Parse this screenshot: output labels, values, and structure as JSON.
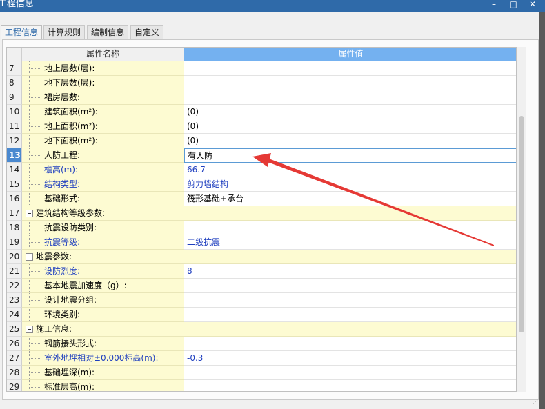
{
  "window": {
    "title": "工程信息",
    "min": "–",
    "max": "□",
    "close": "✕"
  },
  "tabs": [
    {
      "label": "工程信息",
      "active": true
    },
    {
      "label": "计算规则",
      "active": false
    },
    {
      "label": "编制信息",
      "active": false
    },
    {
      "label": "自定义",
      "active": false
    }
  ],
  "grid": {
    "col_name": "属性名称",
    "col_value": "属性值",
    "rows": [
      {
        "num": "7",
        "name": "地上层数(层):",
        "value": "",
        "group": false,
        "blue": false
      },
      {
        "num": "8",
        "name": "地下层数(层):",
        "value": "",
        "group": false,
        "blue": false
      },
      {
        "num": "9",
        "name": "裙房层数:",
        "value": "",
        "group": false,
        "blue": false
      },
      {
        "num": "10",
        "name": "建筑面积(m²):",
        "value": "(0)",
        "group": false,
        "blue": false
      },
      {
        "num": "11",
        "name": "地上面积(m²):",
        "value": "(0)",
        "group": false,
        "blue": false
      },
      {
        "num": "12",
        "name": "地下面积(m²):",
        "value": "(0)",
        "group": false,
        "blue": false
      },
      {
        "num": "13",
        "name": "人防工程:",
        "value": "有人防",
        "group": false,
        "blue": false,
        "selected": true
      },
      {
        "num": "14",
        "name": "檐高(m):",
        "value": "66.7",
        "group": false,
        "blue": true
      },
      {
        "num": "15",
        "name": "结构类型:",
        "value": "剪力墙结构",
        "group": false,
        "blue": true
      },
      {
        "num": "16",
        "name": "基础形式:",
        "value": "筏形基础+承台",
        "group": false,
        "blue": false
      },
      {
        "num": "17",
        "name": "建筑结构等级参数:",
        "value": "",
        "group": true,
        "blue": false
      },
      {
        "num": "18",
        "name": "抗震设防类别:",
        "value": "",
        "group": false,
        "blue": false
      },
      {
        "num": "19",
        "name": "抗震等级:",
        "value": "二级抗震",
        "group": false,
        "blue": true
      },
      {
        "num": "20",
        "name": "地震参数:",
        "value": "",
        "group": true,
        "blue": false
      },
      {
        "num": "21",
        "name": "设防烈度:",
        "value": "8",
        "group": false,
        "blue": true
      },
      {
        "num": "22",
        "name": "基本地震加速度（g）:",
        "value": "",
        "group": false,
        "blue": false
      },
      {
        "num": "23",
        "name": "设计地震分组:",
        "value": "",
        "group": false,
        "blue": false
      },
      {
        "num": "24",
        "name": "环境类别:",
        "value": "",
        "group": false,
        "blue": false
      },
      {
        "num": "25",
        "name": "施工信息:",
        "value": "",
        "group": true,
        "blue": false
      },
      {
        "num": "26",
        "name": "钢筋接头形式:",
        "value": "",
        "group": false,
        "blue": false
      },
      {
        "num": "27",
        "name": "室外地坪相对±0.000标高(m):",
        "value": "-0.3",
        "group": false,
        "blue": true
      },
      {
        "num": "28",
        "name": "基础埋深(m):",
        "value": "",
        "group": false,
        "blue": false
      },
      {
        "num": "29",
        "name": "标准层高(m):",
        "value": "",
        "group": false,
        "blue": false
      }
    ]
  },
  "annotation": {
    "color": "#e53935",
    "icon": "red-arrow"
  }
}
